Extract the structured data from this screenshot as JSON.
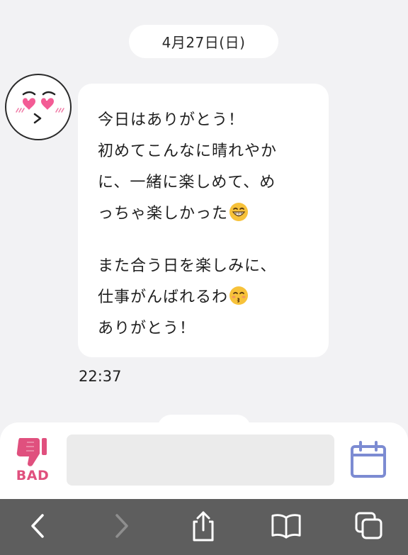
{
  "chat": {
    "date_label": "4月27日(日)",
    "message": {
      "lines": [
        "今日はありがとう！",
        "初めてこんなに晴れやか",
        "に、一緒に楽しめて、め",
        "っちゃ楽しかった"
      ],
      "lines2": [
        "また合う日を楽しみに、",
        "仕事がんばれるわ",
        "ありがとう！"
      ],
      "emoji_1": "grinning-face-with-smiling-eyes",
      "emoji_2": "kissing-face-with-smiling-eyes"
    },
    "time": "22:37"
  },
  "composer": {
    "bad_label": "BAD",
    "input_value": "",
    "icons": {
      "bad": "thumbs-down-icon",
      "calendar": "calendar-icon"
    }
  },
  "browser_toolbar": {
    "icons": [
      "back-icon",
      "forward-icon",
      "share-icon",
      "bookmarks-icon",
      "tabs-icon"
    ]
  },
  "colors": {
    "background": "#F2F2F4",
    "bad_accent": "#E0507E",
    "calendar_accent": "#7C8BD2",
    "toolbar": "#5E5E5E"
  }
}
